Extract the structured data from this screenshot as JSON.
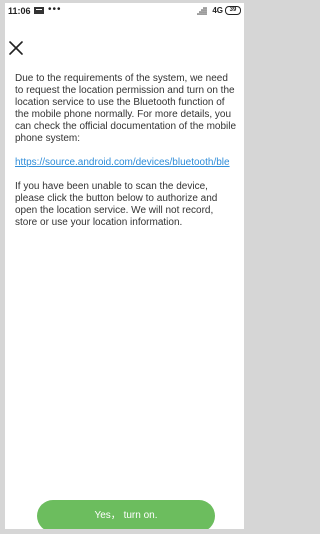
{
  "status_bar": {
    "time": "11:06",
    "more": "•••",
    "network": "4G",
    "battery": "39"
  },
  "icons": {
    "close": "close-icon",
    "notification": "notification-icon",
    "signal": "signal-icon",
    "battery": "battery-icon"
  },
  "content": {
    "paragraph_1": "Due to the requirements of the system, we need to request the location permission and turn on the location service to use the Bluetooth function of the mobile phone normally. For more details, you can check the official documentation of the mobile phone system:",
    "link": "https://source.android.com/devices/bluetooth/ble",
    "paragraph_2": "If you have been unable to scan the device, please click the button below to authorize and open the location service. We will not record, store or use your location information."
  },
  "button": {
    "label": "Yes， turn on."
  },
  "colors": {
    "accent": "#6cbd5e",
    "link": "#2f8dd9",
    "text": "#333333",
    "frame": "#d6d6d6"
  }
}
